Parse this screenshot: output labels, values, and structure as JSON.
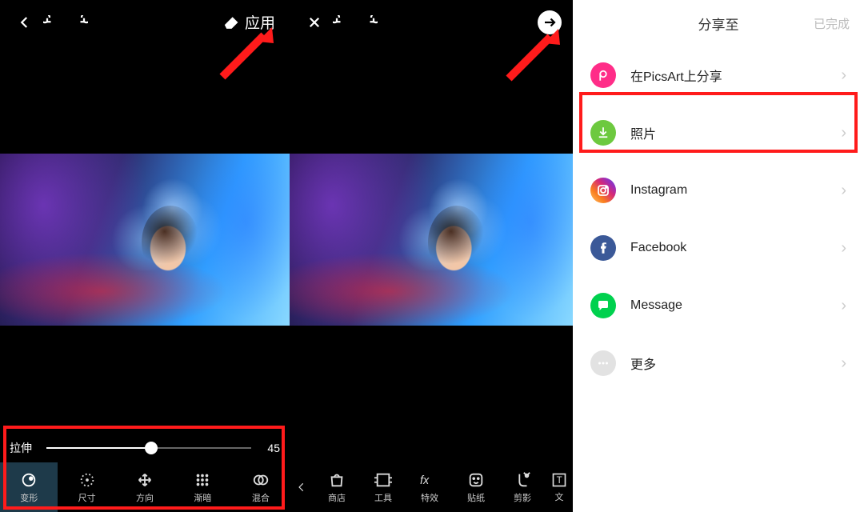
{
  "panel1": {
    "apply": "应用",
    "slider": {
      "label": "拉伸",
      "value": "45"
    },
    "tools": [
      {
        "label": "变形",
        "active": true
      },
      {
        "label": "尺寸"
      },
      {
        "label": "方向"
      },
      {
        "label": "渐暗"
      },
      {
        "label": "混合"
      }
    ]
  },
  "panel2": {
    "tools": [
      {
        "label": "商店"
      },
      {
        "label": "工具"
      },
      {
        "label": "特效"
      },
      {
        "label": "贴纸"
      },
      {
        "label": "剪影"
      },
      {
        "label": "文"
      }
    ]
  },
  "panel3": {
    "title": "分享至",
    "done": "已完成",
    "rows": [
      {
        "label": "在PicsArt上分享",
        "icon": "picsart"
      },
      {
        "label": "照片",
        "icon": "download"
      },
      {
        "label": "Instagram",
        "icon": "insta"
      },
      {
        "label": "Facebook",
        "icon": "fb"
      },
      {
        "label": "Message",
        "icon": "msg"
      },
      {
        "label": "更多",
        "icon": "more"
      }
    ]
  }
}
